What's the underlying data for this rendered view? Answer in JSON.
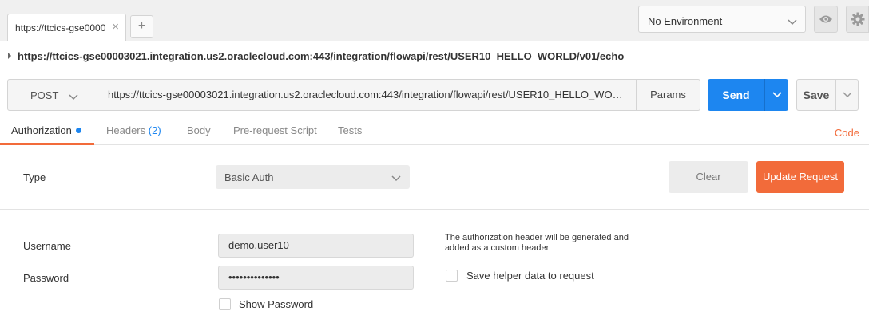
{
  "tab": {
    "label": "https://ttcics-gse0000",
    "close": "×",
    "add": "+"
  },
  "environment": {
    "selected": "No Environment"
  },
  "url_title": "https://ttcics-gse00003021.integration.us2.oraclecloud.com:443/integration/flowapi/rest/USER10_HELLO_WORLD/v01/echo",
  "request": {
    "method": "POST",
    "url_value": "https://ttcics-gse00003021.integration.us2.oraclecloud.com:443/integration/flowapi/rest/USER10_HELLO_WORLD/v01/echo",
    "params_label": "Params",
    "send_label": "Send",
    "save_label": "Save"
  },
  "tabs": {
    "authorization": "Authorization",
    "headers": "Headers",
    "headers_count": "(2)",
    "body": "Body",
    "prerequest": "Pre-request Script",
    "tests": "Tests",
    "code": "Code"
  },
  "auth": {
    "type_label": "Type",
    "type_value": "Basic Auth",
    "clear_label": "Clear",
    "update_label": "Update Request",
    "username_label": "Username",
    "username_value": "demo.user10",
    "password_label": "Password",
    "password_value": "••••••••••••••",
    "show_password_label": "Show Password",
    "note": "The authorization header will be generated and added as a custom header",
    "save_helper_label": "Save helper data to request"
  },
  "colors": {
    "accent": "#f26b3a",
    "primary": "#1d86f0"
  },
  "icons": {
    "env_dropdown": "chevron-down-icon",
    "quick_look": "eye-icon",
    "settings": "gear-icon"
  }
}
